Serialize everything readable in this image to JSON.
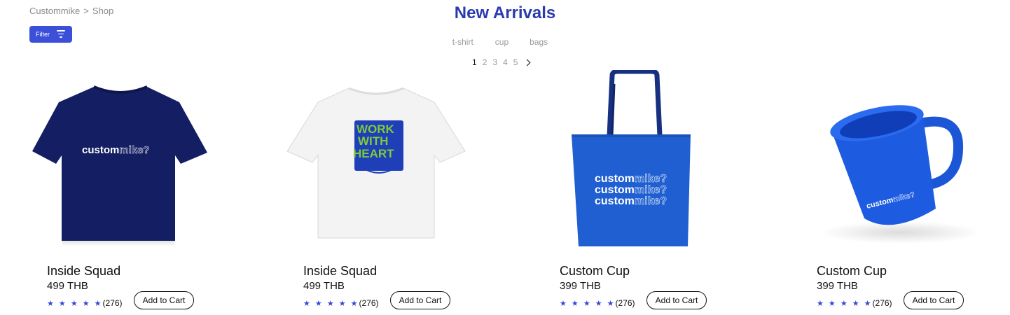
{
  "breadcrumb": {
    "root": "Custommike",
    "separator": ">",
    "current": "Shop"
  },
  "filter": {
    "label": "Filter",
    "icon": "filter-lines-icon"
  },
  "page_title": "New Arrivals",
  "categories": [
    "t-shirt",
    "cup",
    "bags"
  ],
  "pagination": {
    "pages": [
      "1",
      "2",
      "3",
      "4",
      "5"
    ],
    "current": "1",
    "next_icon": "chevron-right-icon"
  },
  "brand": {
    "bold": "custom",
    "outline": "mike?"
  },
  "shirt_print": {
    "line1": "WORK",
    "line2": "WITH",
    "line3": "HEART"
  },
  "colors": {
    "accent": "#3b4fd8",
    "title": "#2a3bb0",
    "navy": "#141f63",
    "royal_blue": "#1f5fd1",
    "star": "#3349d6",
    "green": "#7ecb3a"
  },
  "products": [
    {
      "name": "Inside  Squad",
      "price": "499 THB",
      "stars": "★ ★ ★ ★ ★",
      "rating": 5,
      "count": "(276)",
      "cta": "Add to Cart"
    },
    {
      "name": "Inside  Squad",
      "price": "499 THB",
      "stars": "★ ★ ★ ★ ★",
      "rating": 5,
      "count": "(276)",
      "cta": "Add to Cart"
    },
    {
      "name": "Custom Cup",
      "price": "399 THB",
      "stars": "★ ★ ★ ★ ★",
      "rating": 5,
      "count": "(276)",
      "cta": "Add to Cart"
    },
    {
      "name": "Custom Cup",
      "price": "399 THB",
      "stars": "★ ★ ★ ★ ★",
      "rating": 5,
      "count": "(276)",
      "cta": "Add to Cart"
    }
  ]
}
